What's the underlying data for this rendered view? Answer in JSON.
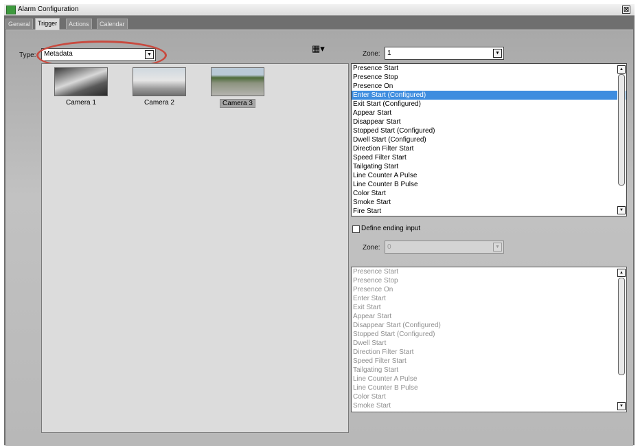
{
  "window": {
    "title": "Alarm Configuration",
    "close_glyph": "☒"
  },
  "tabs": [
    {
      "label": "General"
    },
    {
      "label": "Trigger"
    },
    {
      "label": "Actions"
    },
    {
      "label": "Calendar"
    }
  ],
  "trigger": {
    "type_label": "Type:",
    "type_value": "Metadata",
    "layout_icon_glyph": "▦▾",
    "cameras": [
      {
        "label": "Camera 1"
      },
      {
        "label": "Camera 2"
      },
      {
        "label": "Camera 3"
      }
    ],
    "selected_camera": "Camera 3",
    "zone_label": "Zone:",
    "zone_value": "1",
    "start_events": [
      "Presence Start",
      "Presence Stop",
      "Presence On",
      "Enter Start (Configured)",
      "Exit Start (Configured)",
      "Appear Start",
      "Disappear Start",
      "Stopped Start (Configured)",
      "Dwell Start (Configured)",
      "Direction Filter Start",
      "Speed Filter Start",
      "Tailgating Start",
      "Line Counter A Pulse",
      "Line Counter B Pulse",
      "Color Start",
      "Smoke Start",
      "Fire Start"
    ],
    "selected_event": "Enter Start (Configured)",
    "define_ending_label": "Define ending input",
    "define_ending_checked": false,
    "ending_zone_label": "Zone:",
    "ending_zone_value": "0",
    "end_events": [
      "Presence Start",
      "Presence Stop",
      "Presence On",
      "Enter Start",
      "Exit Start",
      "Appear Start",
      "Disappear Start (Configured)",
      "Stopped Start (Configured)",
      "Dwell Start",
      "Direction Filter Start",
      "Speed Filter Start",
      "Tailgating Start",
      "Line Counter A Pulse",
      "Line Counter B Pulse",
      "Color Start",
      "Smoke Start"
    ]
  },
  "colors": {
    "selection": "#3e8ddf",
    "highlight_ring": "#c84a3f"
  }
}
